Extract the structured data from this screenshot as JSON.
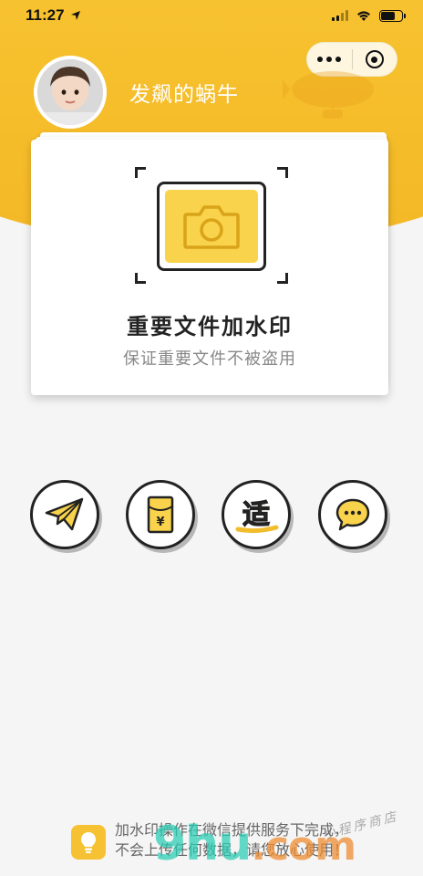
{
  "status_bar": {
    "time": "11:27",
    "location_icon": "location-arrow-icon",
    "signal_icon": "cellular-signal-icon",
    "wifi_icon": "wifi-icon",
    "battery_icon": "battery-icon"
  },
  "capsule": {
    "more_icon": "more-dots-icon",
    "close_icon": "close-target-icon"
  },
  "profile": {
    "nickname": "发飙的蜗牛"
  },
  "main_card": {
    "title": "重要文件加水印",
    "subtitle": "保证重要文件不被盗用",
    "icon": "camera-icon"
  },
  "actions": [
    {
      "icon": "paper-plane-icon"
    },
    {
      "icon": "red-envelope-yen-icon"
    },
    {
      "icon": "calligraphy-shi-icon",
      "glyph": "适"
    },
    {
      "icon": "chat-bubble-icon"
    }
  ],
  "tip": {
    "icon": "lightbulb-icon",
    "line1": "加水印操作在微信提供服务下完成，",
    "line2": "不会上传任何数据，请您放心使用！"
  },
  "watermark": {
    "logo_main": "9hu",
    "logo_suffix": ".com",
    "caption": "小程序商店"
  },
  "colors": {
    "brand_yellow": "#f6bf2c",
    "card_icon_yellow": "#f9d34b",
    "text_dark": "#222222",
    "text_gray": "#888888",
    "background": "#f5f5f5"
  }
}
